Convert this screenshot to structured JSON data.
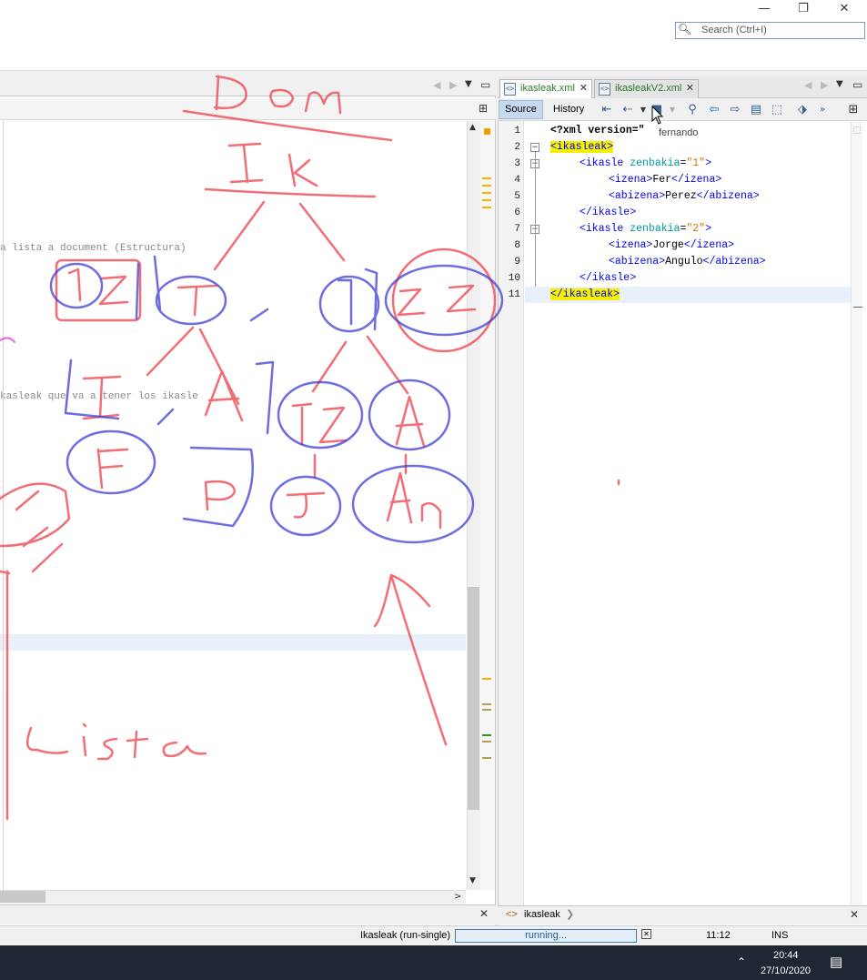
{
  "window": {
    "minimize": "—",
    "restore": "❐",
    "close": "✕"
  },
  "search": {
    "placeholder": "Search (Ctrl+I)"
  },
  "left_editor": {
    "lines": [
      {
        "text": "a lista a document (Estructura)"
      },
      {
        "text": "kasleak que va a tener los ikasle"
      }
    ]
  },
  "tabs": [
    {
      "label": "ikasleak.xml",
      "active": true
    },
    {
      "label": "ikasleakV2.xml",
      "active": false
    }
  ],
  "editor_toolbar": {
    "source": "Source",
    "history": "History"
  },
  "tooltip": "fernando",
  "code": {
    "line_numbers": [
      "1",
      "2",
      "3",
      "4",
      "5",
      "6",
      "7",
      "8",
      "9",
      "10",
      "11"
    ],
    "line1": {
      "pi": "<?xml version=\"",
      "rest": ""
    },
    "root_open": "<ikasleak>",
    "ikasle1": {
      "open": "<ikasle",
      "attr": "zenbakia",
      "eq": "=",
      "val": "\"1\"",
      "close": ">"
    },
    "izena1": {
      "open": "<izena>",
      "text": "Fer",
      "close": "</izena>"
    },
    "abizena1": {
      "open": "<abizena>",
      "text": "Perez",
      "close": "</abizena>"
    },
    "ikasle1_close": "</ikasle>",
    "ikasle2": {
      "open": "<ikasle",
      "attr": "zenbakia",
      "eq": "=",
      "val": "\"2\"",
      "close": ">"
    },
    "izena2": {
      "open": "<izena>",
      "text": "Jorge",
      "close": "</izena>"
    },
    "abizena2": {
      "open": "<abizena>",
      "text": "Angulo",
      "close": "</abizena>"
    },
    "ikasle2_close": "</ikasle>",
    "root_close": "</ikasleak>"
  },
  "breadcrumb": {
    "item": "ikasleak"
  },
  "statusbar": {
    "task": "Ikasleak (run-single)",
    "progress_text": "running...",
    "position": "11:12",
    "mode": "INS"
  },
  "taskbar": {
    "time": "20:44",
    "date": "27/10/2020"
  },
  "annotations": {
    "dom": "Dom",
    "ik": "Ik",
    "lista": "Lista"
  },
  "colors": {
    "ink_red": "#ee4b55",
    "ink_blue": "#3d3dd6",
    "tag_blue": "#0000e6",
    "attr_teal": "#009999",
    "value_orange": "#ce7b00",
    "highlight_yellow": "#f5f000"
  }
}
